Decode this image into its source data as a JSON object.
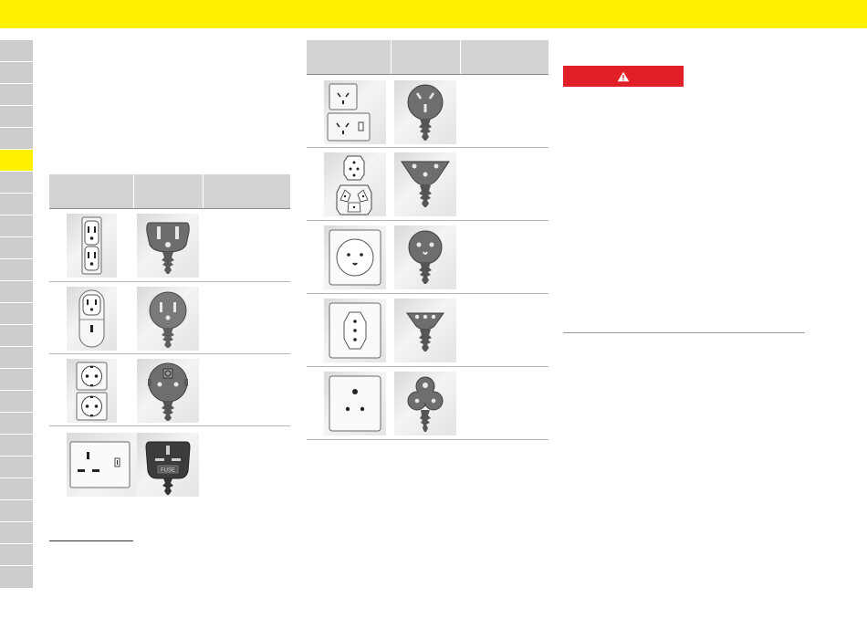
{
  "colors": {
    "header_band": "#fff200",
    "nav_tab": "#cccccc",
    "nav_tab_active": "#fff200",
    "table_header": "#d3d3d3",
    "warning": "#e11f26"
  },
  "side_nav": {
    "tab_count": 25,
    "active_index": 5
  },
  "left_table": {
    "rows": [
      {
        "socket_icon": "us-duplex-socket-icon",
        "plug_icon": "us-type-b-plug-icon"
      },
      {
        "socket_icon": "us-adapter-socket-icon",
        "plug_icon": "us-round-plug-icon"
      },
      {
        "socket_icon": "schuko-socket-icon",
        "plug_icon": "schuko-plug-icon"
      },
      {
        "socket_icon": "uk-switched-socket-icon",
        "plug_icon": "uk-fused-plug-icon",
        "plug_text": "FUSE"
      }
    ]
  },
  "right_table": {
    "rows": [
      {
        "socket_icon": "australian-socket-icon",
        "plug_icon": "australian-plug-icon"
      },
      {
        "socket_icon": "swiss-triple-socket-icon",
        "plug_icon": "swiss-plug-icon"
      },
      {
        "socket_icon": "danish-socket-icon",
        "plug_icon": "danish-plug-icon"
      },
      {
        "socket_icon": "swiss-socket-icon",
        "plug_icon": "swiss-slim-plug-icon"
      },
      {
        "socket_icon": "indian-socket-icon",
        "plug_icon": "indian-plug-icon"
      }
    ]
  },
  "warning": {
    "icon": "warning-triangle-icon"
  }
}
